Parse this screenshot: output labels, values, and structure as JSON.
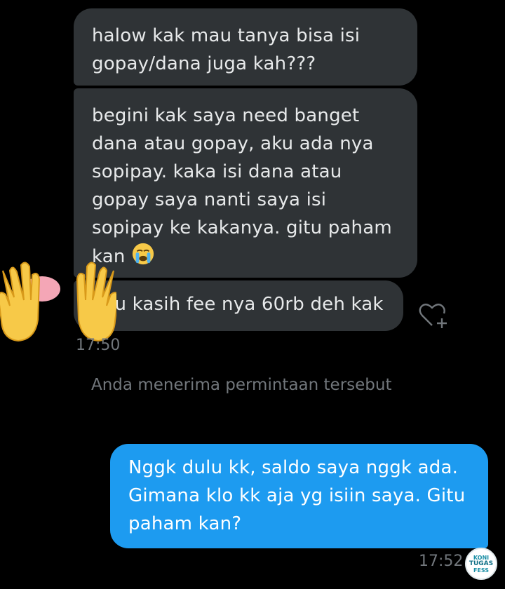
{
  "messages": {
    "received": [
      {
        "text": "halow kak mau tanya bisa isi gopay/dana juga kah???"
      },
      {
        "text": "begini kak saya need banget dana atau gopay, aku ada nya sopipay. kaka isi dana atau gopay saya nanti saya isi sopipay ke kakanya. gitu paham kan",
        "emoji": "loudly-crying-face-emoji"
      },
      {
        "text": "ku kasih fee nya 60rb deh kak"
      }
    ],
    "received_time": "17:50",
    "system_notice": "Anda menerima permintaan tersebut",
    "sent": {
      "text": "Nggk dulu kk, saldo saya nggk ada. Gimana klo kk aja yg isiin saya. Gitu paham kan?"
    },
    "sent_time": "17:52"
  },
  "icons": {
    "reaction": "heart-plus-icon",
    "overlay": "raised-hands-emoji",
    "watermark": "watermark-badge"
  },
  "watermark_text": [
    "KONI",
    "TUGAS",
    "FESS"
  ],
  "colors": {
    "background": "#000000",
    "received_bubble": "#2f3336",
    "sent_bubble": "#1d9bf0",
    "muted_text": "#71767b"
  }
}
